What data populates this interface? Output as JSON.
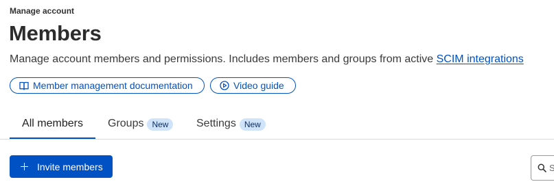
{
  "breadcrumb": "Manage account",
  "page_title": "Members",
  "description": {
    "text": "Manage account members and permissions. Includes members and groups from active ",
    "link_text": "SCIM integrations"
  },
  "resource_links": {
    "docs_label": "Member management documentation",
    "video_label": "Video guide"
  },
  "tabs": [
    {
      "label": "All members",
      "badge": "",
      "active": true
    },
    {
      "label": "Groups",
      "badge": "New",
      "active": false
    },
    {
      "label": "Settings",
      "badge": "New",
      "active": false
    }
  ],
  "actions": {
    "invite_label": "Invite members"
  },
  "search": {
    "placeholder": "S"
  },
  "colors": {
    "accent": "#0051c3",
    "badge_bg": "#cfe3fb"
  },
  "icons": {
    "docs": "book-icon",
    "video": "play-circle-icon",
    "invite": "plus-icon",
    "search": "search-icon"
  }
}
